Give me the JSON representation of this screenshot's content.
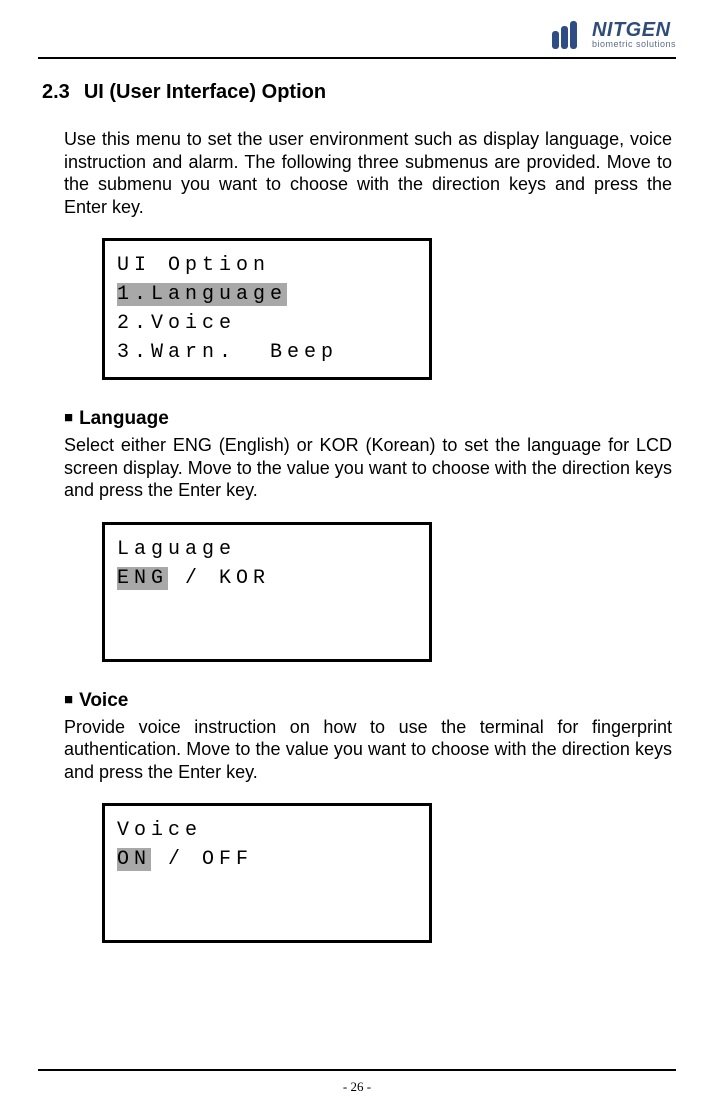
{
  "brand": {
    "name": "NITGEN",
    "tagline": "biometric solutions"
  },
  "section": {
    "number": "2.3",
    "title": "UI (User Interface) Option",
    "intro": "Use this menu to set the user environment such as display language, voice instruction and alarm. The following three submenus are provided. Move to the submenu you want to choose with the direction keys and press the Enter key."
  },
  "lcd1": {
    "l1": "UI Option",
    "l2": "1.Language",
    "l3": "2.Voice",
    "l4": "3.Warn.  Beep"
  },
  "language": {
    "heading": "Language",
    "body": "Select either ENG (English) or KOR (Korean) to set the language for LCD screen display. Move to the value you want to choose with the direction keys and press the Enter key.",
    "lcd": {
      "l1": "Laguage",
      "sel": "ENG",
      "rest": " / KOR"
    }
  },
  "voice": {
    "heading": "Voice",
    "body": "Provide voice instruction on how to use the terminal for fingerprint authentication. Move to the value you want to choose with the direction keys and press the Enter key.",
    "lcd": {
      "l1": "Voice",
      "sel": "ON",
      "rest": " / OFF"
    }
  },
  "page_number": "- 26 -"
}
